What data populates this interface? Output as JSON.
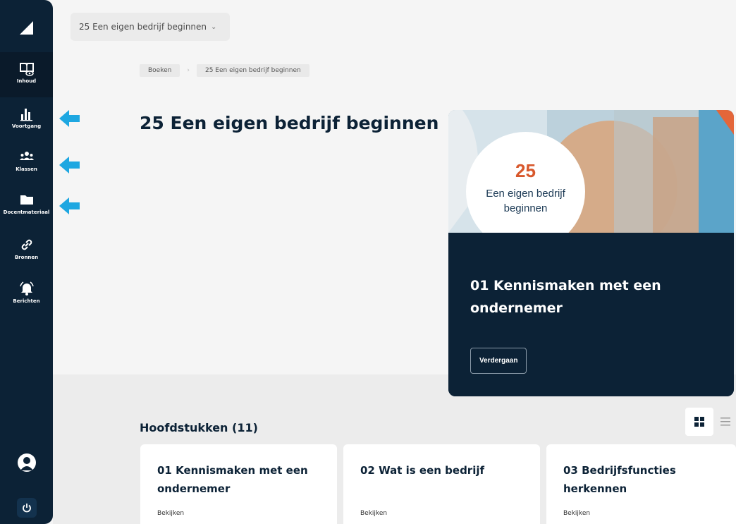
{
  "sidebar": {
    "items": [
      {
        "label": "Inhoud",
        "icon": "book-eye-icon"
      },
      {
        "label": "Voortgang",
        "icon": "bar-chart-icon"
      },
      {
        "label": "Klassen",
        "icon": "people-icon"
      },
      {
        "label": "Docentmateriaal",
        "icon": "folder-icon"
      },
      {
        "label": "Bronnen",
        "icon": "link-icon"
      },
      {
        "label": "Berichten",
        "icon": "bell-icon"
      }
    ],
    "account_icon": "user-avatar-icon",
    "logout_icon": "power-icon"
  },
  "header": {
    "book_selector": "25 Een eigen bedrijf beginnen"
  },
  "breadcrumb": [
    "Boeken",
    "25 Een eigen bedrijf beginnen"
  ],
  "page_title": "25 Een eigen bedrijf beginnen",
  "feature_card": {
    "badge_number": "25",
    "badge_text": "Een eigen bedrijf beginnen",
    "title": "01 Kennismaken met een ondernemer",
    "button": "Verdergaan"
  },
  "chapters": {
    "heading": "Hoofdstukken (11)",
    "items": [
      {
        "title": "01 Kennismaken met een ondernemer",
        "link": "Bekijken"
      },
      {
        "title": "02 Wat is een bedrijf",
        "link": "Bekijken"
      },
      {
        "title": "03 Bedrijfsfuncties herkennen",
        "link": "Bekijken"
      }
    ]
  },
  "colors": {
    "sidebar": "#0c2236",
    "accent_arrow": "#1ea7e1",
    "badge_number": "#d8582c"
  }
}
